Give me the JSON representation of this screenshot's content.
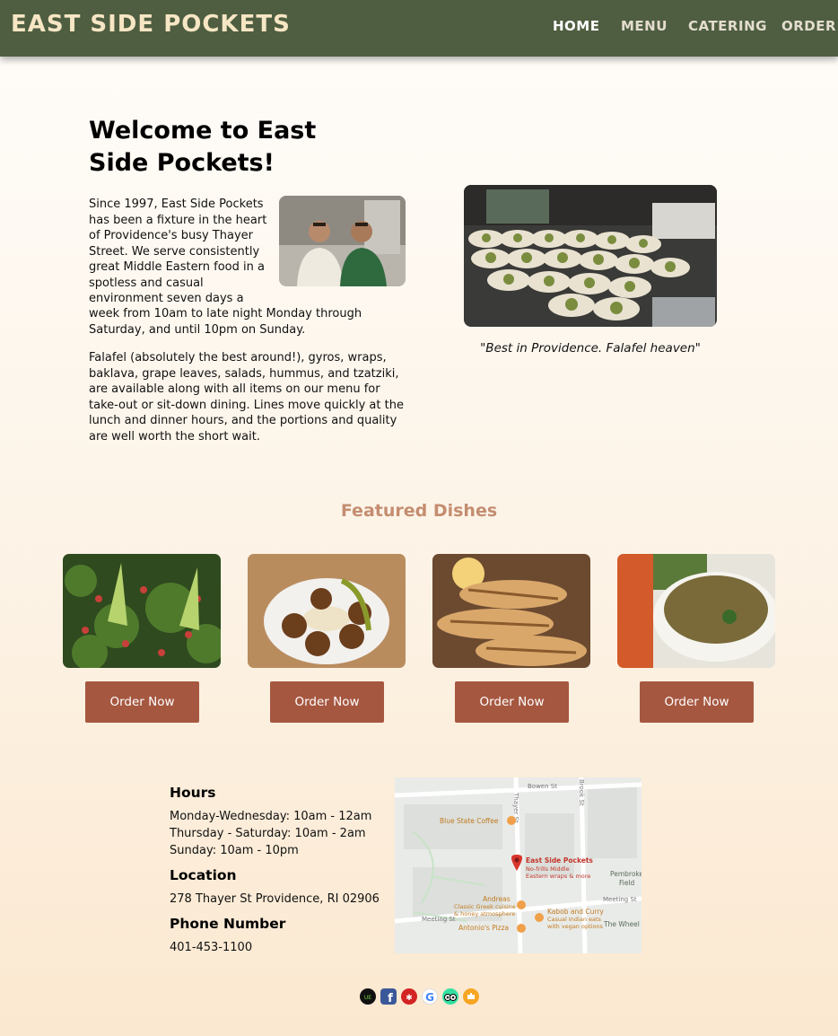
{
  "nav": {
    "brand": "EAST SIDE POCKETS",
    "links": [
      {
        "label": "HOME",
        "active": true
      },
      {
        "label": "MENU"
      },
      {
        "label": "CATERING"
      },
      {
        "label": "ORDER"
      }
    ]
  },
  "welcome": {
    "title": "Welcome to East Side Pockets!",
    "para1_a": "Since 1997, East Side Pockets has been a fixture in the heart of Providence's busy Thayer Street. We serve consistently great Middle Eastern food in a spotless and casual environment seven days a",
    "para1_b": "week from 10am to late night Monday through Saturday, and until 10pm on Sunday.",
    "para2": "Falafel (absolutely the best around!), gyros, wraps, baklava, grape leaves, salads, hummus, and tzatziki, are available along with all items on our menu for take-out or sit-down dining. Lines move quickly at the lunch and dinner hours, and the portions and quality are well worth the short wait.",
    "quote": "\"Best in Providence. Falafel heaven\""
  },
  "featured": {
    "title": "Featured Dishes",
    "dishes": [
      {
        "name": "tabbouleh",
        "button": "Order Now"
      },
      {
        "name": "falafel",
        "button": "Order Now"
      },
      {
        "name": "grilled-chicken",
        "button": "Order Now"
      },
      {
        "name": "lentil-soup",
        "button": "Order Now"
      }
    ]
  },
  "info": {
    "hours_title": "Hours",
    "hours": [
      "Monday-Wednesday: 10am - 12am",
      "Thursday - Saturday: 10am - 2am",
      "Sunday: 10am - 10pm"
    ],
    "location_title": "Location",
    "address": "278 Thayer St Providence, RI 02906",
    "phone_title": "Phone Number",
    "phone": "401-453-1100"
  },
  "map": {
    "streets": [
      "Bowen St",
      "Thayer St",
      "Brook St",
      "Meeting St",
      "Meeting St"
    ],
    "pins": [
      {
        "name": "Blue State Coffee"
      },
      {
        "name": "East Side Pockets",
        "sub1": "No-frills Middle",
        "sub2": "Eastern wraps & more"
      },
      {
        "name": "Andreas",
        "sub1": "Classic Greek cuisine",
        "sub2": "& honey atmosphere"
      },
      {
        "name": "Kabob and Curry",
        "sub1": "Casual Indian eats",
        "sub2": "with vegan options"
      },
      {
        "name": "Antonio's Pizza"
      }
    ],
    "areas": [
      "Pembroke",
      "Field",
      "The Wheel"
    ]
  },
  "social": [
    "uber-eats-icon",
    "facebook-icon",
    "yelp-icon",
    "google-icon",
    "tripadvisor-icon",
    "grubhub-icon"
  ],
  "colors": {
    "nav": "#4f5e41",
    "brand": "#f7e6c4",
    "button": "#a65740",
    "featured": "#c48d70"
  }
}
